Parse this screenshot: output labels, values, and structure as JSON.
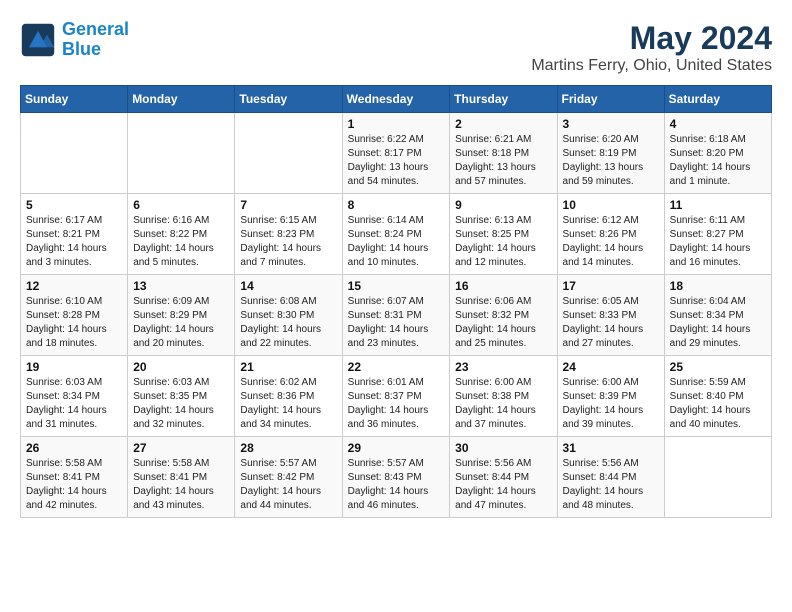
{
  "logo": {
    "text_general": "General",
    "text_blue": "Blue"
  },
  "title": "May 2024",
  "subtitle": "Martins Ferry, Ohio, United States",
  "days_of_week": [
    "Sunday",
    "Monday",
    "Tuesday",
    "Wednesday",
    "Thursday",
    "Friday",
    "Saturday"
  ],
  "weeks": [
    [
      {
        "day": "",
        "sunrise": "",
        "sunset": "",
        "daylight": ""
      },
      {
        "day": "",
        "sunrise": "",
        "sunset": "",
        "daylight": ""
      },
      {
        "day": "",
        "sunrise": "",
        "sunset": "",
        "daylight": ""
      },
      {
        "day": "1",
        "sunrise": "Sunrise: 6:22 AM",
        "sunset": "Sunset: 8:17 PM",
        "daylight": "Daylight: 13 hours and 54 minutes."
      },
      {
        "day": "2",
        "sunrise": "Sunrise: 6:21 AM",
        "sunset": "Sunset: 8:18 PM",
        "daylight": "Daylight: 13 hours and 57 minutes."
      },
      {
        "day": "3",
        "sunrise": "Sunrise: 6:20 AM",
        "sunset": "Sunset: 8:19 PM",
        "daylight": "Daylight: 13 hours and 59 minutes."
      },
      {
        "day": "4",
        "sunrise": "Sunrise: 6:18 AM",
        "sunset": "Sunset: 8:20 PM",
        "daylight": "Daylight: 14 hours and 1 minute."
      }
    ],
    [
      {
        "day": "5",
        "sunrise": "Sunrise: 6:17 AM",
        "sunset": "Sunset: 8:21 PM",
        "daylight": "Daylight: 14 hours and 3 minutes."
      },
      {
        "day": "6",
        "sunrise": "Sunrise: 6:16 AM",
        "sunset": "Sunset: 8:22 PM",
        "daylight": "Daylight: 14 hours and 5 minutes."
      },
      {
        "day": "7",
        "sunrise": "Sunrise: 6:15 AM",
        "sunset": "Sunset: 8:23 PM",
        "daylight": "Daylight: 14 hours and 7 minutes."
      },
      {
        "day": "8",
        "sunrise": "Sunrise: 6:14 AM",
        "sunset": "Sunset: 8:24 PM",
        "daylight": "Daylight: 14 hours and 10 minutes."
      },
      {
        "day": "9",
        "sunrise": "Sunrise: 6:13 AM",
        "sunset": "Sunset: 8:25 PM",
        "daylight": "Daylight: 14 hours and 12 minutes."
      },
      {
        "day": "10",
        "sunrise": "Sunrise: 6:12 AM",
        "sunset": "Sunset: 8:26 PM",
        "daylight": "Daylight: 14 hours and 14 minutes."
      },
      {
        "day": "11",
        "sunrise": "Sunrise: 6:11 AM",
        "sunset": "Sunset: 8:27 PM",
        "daylight": "Daylight: 14 hours and 16 minutes."
      }
    ],
    [
      {
        "day": "12",
        "sunrise": "Sunrise: 6:10 AM",
        "sunset": "Sunset: 8:28 PM",
        "daylight": "Daylight: 14 hours and 18 minutes."
      },
      {
        "day": "13",
        "sunrise": "Sunrise: 6:09 AM",
        "sunset": "Sunset: 8:29 PM",
        "daylight": "Daylight: 14 hours and 20 minutes."
      },
      {
        "day": "14",
        "sunrise": "Sunrise: 6:08 AM",
        "sunset": "Sunset: 8:30 PM",
        "daylight": "Daylight: 14 hours and 22 minutes."
      },
      {
        "day": "15",
        "sunrise": "Sunrise: 6:07 AM",
        "sunset": "Sunset: 8:31 PM",
        "daylight": "Daylight: 14 hours and 23 minutes."
      },
      {
        "day": "16",
        "sunrise": "Sunrise: 6:06 AM",
        "sunset": "Sunset: 8:32 PM",
        "daylight": "Daylight: 14 hours and 25 minutes."
      },
      {
        "day": "17",
        "sunrise": "Sunrise: 6:05 AM",
        "sunset": "Sunset: 8:33 PM",
        "daylight": "Daylight: 14 hours and 27 minutes."
      },
      {
        "day": "18",
        "sunrise": "Sunrise: 6:04 AM",
        "sunset": "Sunset: 8:34 PM",
        "daylight": "Daylight: 14 hours and 29 minutes."
      }
    ],
    [
      {
        "day": "19",
        "sunrise": "Sunrise: 6:03 AM",
        "sunset": "Sunset: 8:34 PM",
        "daylight": "Daylight: 14 hours and 31 minutes."
      },
      {
        "day": "20",
        "sunrise": "Sunrise: 6:03 AM",
        "sunset": "Sunset: 8:35 PM",
        "daylight": "Daylight: 14 hours and 32 minutes."
      },
      {
        "day": "21",
        "sunrise": "Sunrise: 6:02 AM",
        "sunset": "Sunset: 8:36 PM",
        "daylight": "Daylight: 14 hours and 34 minutes."
      },
      {
        "day": "22",
        "sunrise": "Sunrise: 6:01 AM",
        "sunset": "Sunset: 8:37 PM",
        "daylight": "Daylight: 14 hours and 36 minutes."
      },
      {
        "day": "23",
        "sunrise": "Sunrise: 6:00 AM",
        "sunset": "Sunset: 8:38 PM",
        "daylight": "Daylight: 14 hours and 37 minutes."
      },
      {
        "day": "24",
        "sunrise": "Sunrise: 6:00 AM",
        "sunset": "Sunset: 8:39 PM",
        "daylight": "Daylight: 14 hours and 39 minutes."
      },
      {
        "day": "25",
        "sunrise": "Sunrise: 5:59 AM",
        "sunset": "Sunset: 8:40 PM",
        "daylight": "Daylight: 14 hours and 40 minutes."
      }
    ],
    [
      {
        "day": "26",
        "sunrise": "Sunrise: 5:58 AM",
        "sunset": "Sunset: 8:41 PM",
        "daylight": "Daylight: 14 hours and 42 minutes."
      },
      {
        "day": "27",
        "sunrise": "Sunrise: 5:58 AM",
        "sunset": "Sunset: 8:41 PM",
        "daylight": "Daylight: 14 hours and 43 minutes."
      },
      {
        "day": "28",
        "sunrise": "Sunrise: 5:57 AM",
        "sunset": "Sunset: 8:42 PM",
        "daylight": "Daylight: 14 hours and 44 minutes."
      },
      {
        "day": "29",
        "sunrise": "Sunrise: 5:57 AM",
        "sunset": "Sunset: 8:43 PM",
        "daylight": "Daylight: 14 hours and 46 minutes."
      },
      {
        "day": "30",
        "sunrise": "Sunrise: 5:56 AM",
        "sunset": "Sunset: 8:44 PM",
        "daylight": "Daylight: 14 hours and 47 minutes."
      },
      {
        "day": "31",
        "sunrise": "Sunrise: 5:56 AM",
        "sunset": "Sunset: 8:44 PM",
        "daylight": "Daylight: 14 hours and 48 minutes."
      },
      {
        "day": "",
        "sunrise": "",
        "sunset": "",
        "daylight": ""
      }
    ]
  ]
}
